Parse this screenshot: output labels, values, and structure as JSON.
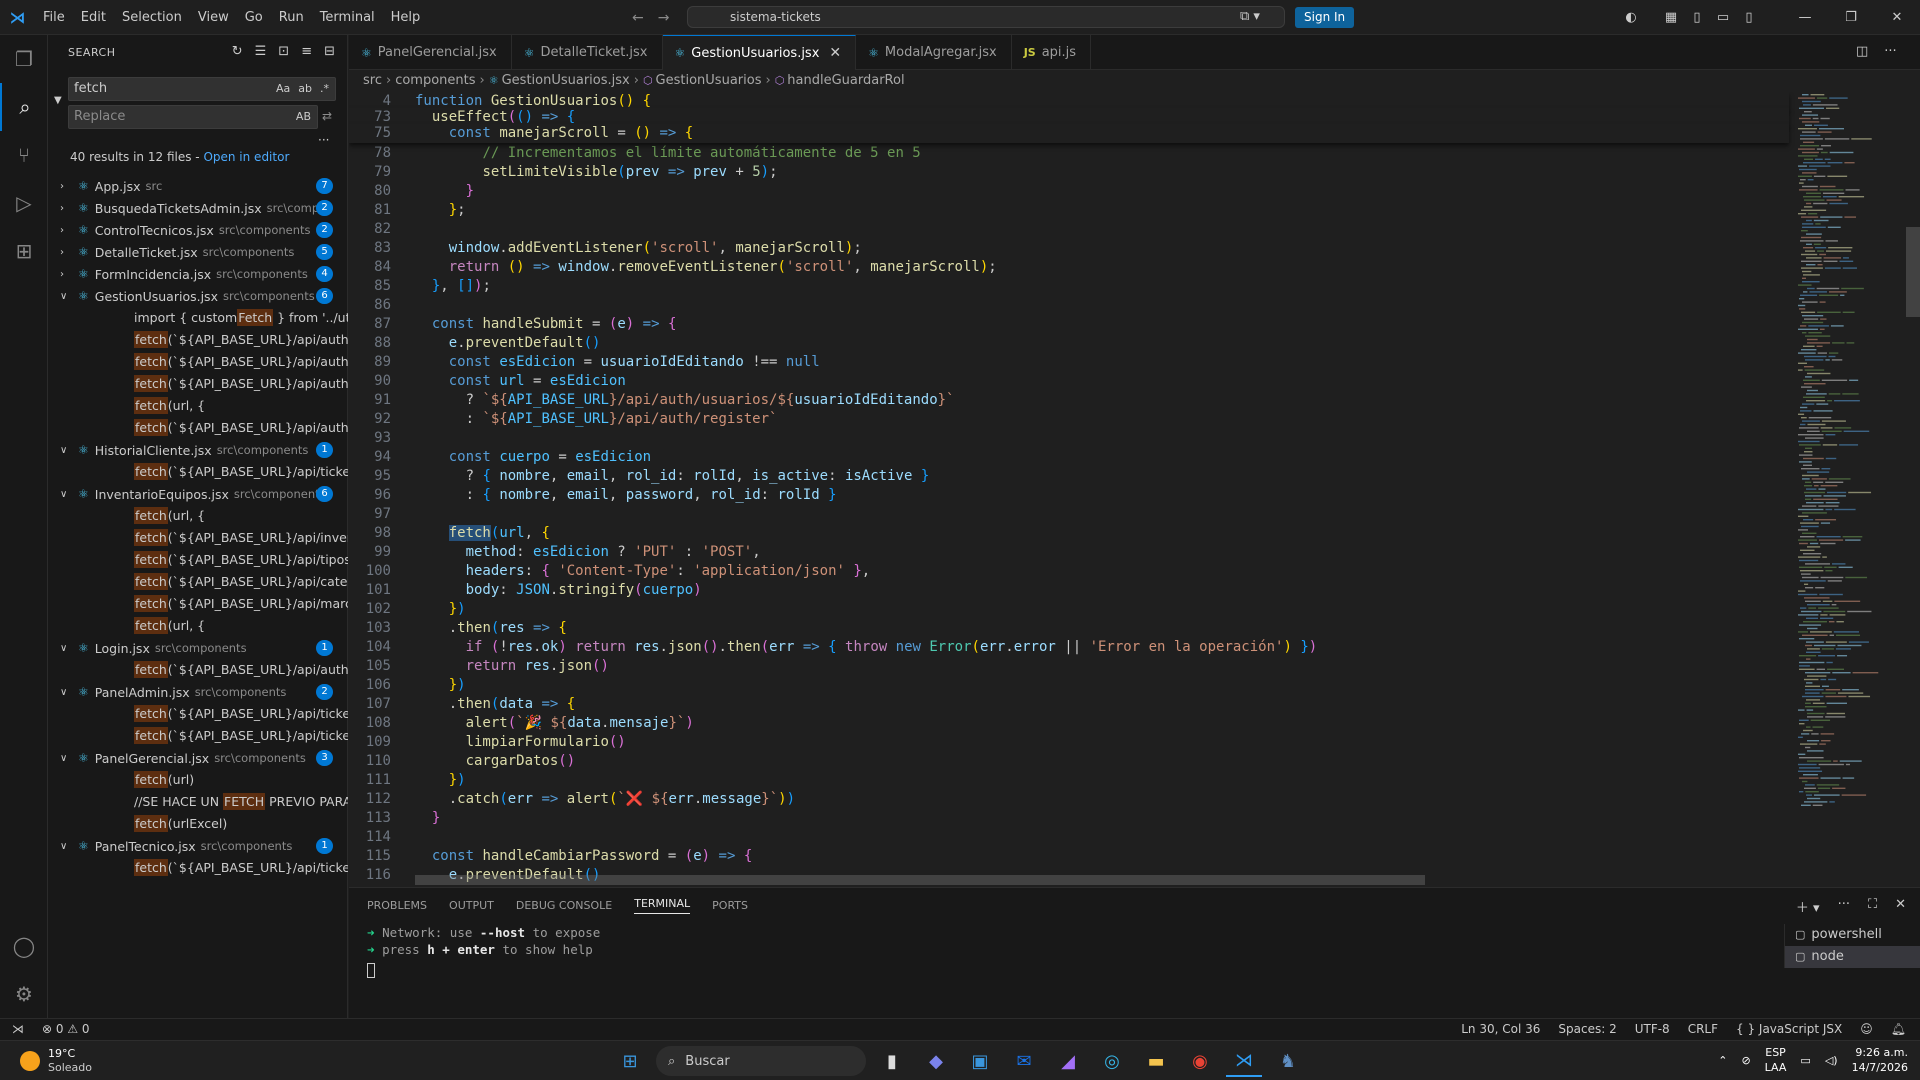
{
  "titlebar": {
    "menu": [
      "File",
      "Edit",
      "Selection",
      "View",
      "Go",
      "Run",
      "Terminal",
      "Help"
    ],
    "search_text": "sistema-tickets",
    "signin_label": "Sign In"
  },
  "sidebar": {
    "title": "SEARCH",
    "search_value": "fetch",
    "search_opts": [
      "Aa",
      "ab",
      ".*"
    ],
    "replace_placeholder": "Replace",
    "replace_opt": "AB",
    "results_summary": "40 results in 12 files - ",
    "open_in_editor": "Open in editor",
    "files": [
      {
        "name": "App.jsx",
        "path": "src",
        "count": "7",
        "expanded": false,
        "matches": []
      },
      {
        "name": "BusquedaTicketsAdmin.jsx",
        "path": "src\\comp...",
        "count": "2",
        "expanded": false,
        "matches": []
      },
      {
        "name": "ControlTecnicos.jsx",
        "path": "src\\components",
        "count": "2",
        "expanded": false,
        "matches": []
      },
      {
        "name": "DetalleTicket.jsx",
        "path": "src\\components",
        "count": "5",
        "expanded": false,
        "matches": []
      },
      {
        "name": "FormIncidencia.jsx",
        "path": "src\\components",
        "count": "4",
        "expanded": false,
        "matches": []
      },
      {
        "name": "GestionUsuarios.jsx",
        "path": "src\\components",
        "count": "6",
        "expanded": true,
        "matches": [
          [
            "import { custom",
            "Fetch",
            " } from '../utils/api';"
          ],
          [
            "",
            "fetch",
            "(`${API_BASE_URL}/api/auth/roles`, {"
          ],
          [
            "",
            "fetch",
            "(`${API_BASE_URL}/api/auth/usuarios`)...."
          ],
          [
            "",
            "fetch",
            "(`${API_BASE_URL}/api/auth/roles`).the..."
          ],
          [
            "",
            "fetch",
            "(url, {"
          ],
          [
            "",
            "fetch",
            "(`${API_BASE_URL}/api/auth/usuarios/$..."
          ]
        ]
      },
      {
        "name": "HistorialCliente.jsx",
        "path": "src\\components",
        "count": "1",
        "expanded": true,
        "matches": [
          [
            "",
            "fetch",
            "(`${API_BASE_URL}/api/tickets/cliente/..."
          ]
        ]
      },
      {
        "name": "InventarioEquipos.jsx",
        "path": "src\\components",
        "count": "6",
        "expanded": true,
        "matches": [
          [
            "",
            "fetch",
            "(url, {"
          ],
          [
            "",
            "fetch",
            "(`${API_BASE_URL}/api/inventario`).the..."
          ],
          [
            "",
            "fetch",
            "(`${API_BASE_URL}/api/tipos-equipos-..."
          ],
          [
            "",
            "fetch",
            "(`${API_BASE_URL}/api/categorias-inve..."
          ],
          [
            "",
            "fetch",
            "(`${API_BASE_URL}/api/marcas`).then(r..."
          ],
          [
            "",
            "fetch",
            "(url, {"
          ]
        ]
      },
      {
        "name": "Login.jsx",
        "path": "src\\components",
        "count": "1",
        "expanded": true,
        "matches": [
          [
            "",
            "fetch",
            "(`${API_BASE_URL}/api/auth/login`, {"
          ]
        ]
      },
      {
        "name": "PanelAdmin.jsx",
        "path": "src\\components",
        "count": "2",
        "expanded": true,
        "matches": [
          [
            "",
            "fetch",
            "(`${API_BASE_URL}/api/tickets/dashboa..."
          ],
          [
            "",
            "fetch",
            "(`${API_BASE_URL}/api/tickets/dashboa..."
          ]
        ]
      },
      {
        "name": "PanelGerencial.jsx",
        "path": "src\\components",
        "count": "3",
        "expanded": true,
        "matches": [
          [
            "",
            "fetch",
            "(url)"
          ],
          [
            "//SE HACE UN ",
            "FETCH",
            " PREVIO PARA EVALUA..."
          ],
          [
            "",
            "fetch",
            "(urlExcel)"
          ]
        ]
      },
      {
        "name": "PanelTecnico.jsx",
        "path": "src\\components",
        "count": "1",
        "expanded": true,
        "matches": [
          [
            "",
            "fetch",
            "(`${API_BASE_URL}/api/tickets/tecnico`)"
          ]
        ]
      }
    ]
  },
  "tabs": [
    {
      "label": "PanelGerencial.jsx",
      "icon": "react-icon",
      "active": false
    },
    {
      "label": "DetalleTicket.jsx",
      "icon": "react-icon",
      "active": false
    },
    {
      "label": "GestionUsuarios.jsx",
      "icon": "react-icon",
      "active": true
    },
    {
      "label": "ModalAgregar.jsx",
      "icon": "react-icon",
      "active": false
    },
    {
      "label": "api.js",
      "icon": "js-icon",
      "active": false
    }
  ],
  "breadcrumb": [
    "src",
    "components",
    "GestionUsuarios.jsx",
    "GestionUsuarios",
    "handleGuardarRol"
  ],
  "code_lines": [
    {
      "n": "4",
      "sticky": true,
      "html": "<span class=\"kw\">function</span> <span class=\"fn\">GestionUsuarios</span><span class=\"br1\">()</span> <span class=\"br1\">{</span>"
    },
    {
      "n": "73",
      "sticky": true,
      "html": "  <span class=\"fn\">useEffect</span><span class=\"br2\">(</span><span class=\"br3\">()</span> <span class=\"kw\">=&gt;</span> <span class=\"br3\">{</span>"
    },
    {
      "n": "75",
      "sticky": true,
      "html": "    <span class=\"kw\">const</span> <span class=\"fn\">manejarScroll</span> = <span class=\"br1\">()</span> <span class=\"kw\">=&gt;</span> <span class=\"br1\">{</span>"
    },
    {
      "n": "78",
      "html": "        <span class=\"com\">// Incrementamos el límite automáticamente de 5 en 5</span>"
    },
    {
      "n": "79",
      "html": "        <span class=\"fn\">setLimiteVisible</span><span class=\"br3\">(</span><span class=\"var\">prev</span> <span class=\"kw\">=&gt;</span> <span class=\"var\">prev</span> + <span class=\"num\">5</span><span class=\"br3\">)</span>;"
    },
    {
      "n": "80",
      "html": "      <span class=\"br2\">}</span>"
    },
    {
      "n": "81",
      "html": "    <span class=\"br1\">}</span>;"
    },
    {
      "n": "82",
      "html": ""
    },
    {
      "n": "83",
      "html": "    <span class=\"var\">window</span>.<span class=\"fn\">addEventListener</span><span class=\"br1\">(</span><span class=\"str\">'scroll'</span>, <span class=\"fn\">manejarScroll</span><span class=\"br1\">)</span>;"
    },
    {
      "n": "84",
      "html": "    <span class=\"kw2\">return</span> <span class=\"br1\">()</span> <span class=\"kw\">=&gt;</span> <span class=\"var\">window</span>.<span class=\"fn\">removeEventListener</span><span class=\"br1\">(</span><span class=\"str\">'scroll'</span>, <span class=\"fn\">manejarScroll</span><span class=\"br1\">)</span>;"
    },
    {
      "n": "85",
      "html": "  <span class=\"br3\">}</span>, <span class=\"br3\">[]</span><span class=\"br2\">)</span>;"
    },
    {
      "n": "86",
      "html": ""
    },
    {
      "n": "87",
      "html": "  <span class=\"kw\">const</span> <span class=\"fn\">handleSubmit</span> = <span class=\"br2\">(</span><span class=\"var\">e</span><span class=\"br2\">)</span> <span class=\"kw\">=&gt;</span> <span class=\"br2\">{</span>"
    },
    {
      "n": "88",
      "html": "    <span class=\"var\">e</span>.<span class=\"fn\">preventDefault</span><span class=\"br3\">()</span>"
    },
    {
      "n": "89",
      "html": "    <span class=\"kw\">const</span> <span class=\"const\">esEdicion</span> = <span class=\"var\">usuarioIdEditando</span> !== <span class=\"kw\">null</span>"
    },
    {
      "n": "90",
      "html": "    <span class=\"kw\">const</span> <span class=\"const\">url</span> = <span class=\"const\">esEdicion</span>"
    },
    {
      "n": "91",
      "html": "      ? <span class=\"str\">`${</span><span class=\"const\">API_BASE_URL</span><span class=\"str\">}/api/auth/usuarios/${</span><span class=\"var\">usuarioIdEditando</span><span class=\"str\">}`</span>"
    },
    {
      "n": "92",
      "html": "      : <span class=\"str\">`${</span><span class=\"const\">API_BASE_URL</span><span class=\"str\">}/api/auth/register`</span>"
    },
    {
      "n": "93",
      "html": ""
    },
    {
      "n": "94",
      "html": "    <span class=\"kw\">const</span> <span class=\"const\">cuerpo</span> = <span class=\"const\">esEdicion</span>"
    },
    {
      "n": "95",
      "html": "      ? <span class=\"br3\">{</span> <span class=\"var\">nombre</span>, <span class=\"var\">email</span>, <span class=\"var\">rol_id</span>: <span class=\"var\">rolId</span>, <span class=\"var\">is_active</span>: <span class=\"var\">isActive</span> <span class=\"br3\">}</span>"
    },
    {
      "n": "96",
      "html": "      : <span class=\"br3\">{</span> <span class=\"var\">nombre</span>, <span class=\"var\">email</span>, <span class=\"var\">password</span>, <span class=\"var\">rol_id</span>: <span class=\"var\">rolId</span> <span class=\"br3\">}</span>"
    },
    {
      "n": "97",
      "html": ""
    },
    {
      "n": "98",
      "html": "    <span class=\"fn hl2\">fetch</span><span class=\"br3\">(</span><span class=\"const\">url</span>, <span class=\"br1\">{</span>"
    },
    {
      "n": "99",
      "html": "      <span class=\"var\">method</span>: <span class=\"const\">esEdicion</span> ? <span class=\"str\">'PUT'</span> : <span class=\"str\">'POST'</span>,"
    },
    {
      "n": "100",
      "html": "      <span class=\"var\">headers</span>: <span class=\"br2\">{</span> <span class=\"str\">'Content-Type'</span>: <span class=\"str\">'application/json'</span> <span class=\"br2\">}</span>,"
    },
    {
      "n": "101",
      "html": "      <span class=\"var\">body</span>: <span class=\"const\">JSON</span>.<span class=\"fn\">stringify</span><span class=\"br2\">(</span><span class=\"const\">cuerpo</span><span class=\"br2\">)</span>"
    },
    {
      "n": "102",
      "html": "    <span class=\"br1\">}</span><span class=\"br3\">)</span>"
    },
    {
      "n": "103",
      "html": "    .<span class=\"fn\">then</span><span class=\"br3\">(</span><span class=\"var\">res</span> <span class=\"kw\">=&gt;</span> <span class=\"br1\">{</span>"
    },
    {
      "n": "104",
      "html": "      <span class=\"kw2\">if</span> <span class=\"br2\">(</span>!<span class=\"var\">res</span>.<span class=\"var\">ok</span><span class=\"br2\">)</span> <span class=\"kw2\">return</span> <span class=\"var\">res</span>.<span class=\"fn\">json</span><span class=\"br2\">()</span>.<span class=\"fn\">then</span><span class=\"br2\">(</span><span class=\"var\">err</span> <span class=\"kw\">=&gt;</span> <span class=\"br3\">{</span> <span class=\"kw2\">throw</span> <span class=\"kw\">new</span> <span class=\"cls\">Error</span><span class=\"br1\">(</span><span class=\"var\">err</span>.<span class=\"var\">error</span> || <span class=\"str\">'Error en la operación'</span><span class=\"br1\">)</span> <span class=\"br3\">}</span><span class=\"br2\">)</span>"
    },
    {
      "n": "105",
      "html": "      <span class=\"kw2\">return</span> <span class=\"var\">res</span>.<span class=\"fn\">json</span><span class=\"br2\">()</span>"
    },
    {
      "n": "106",
      "html": "    <span class=\"br1\">}</span><span class=\"br3\">)</span>"
    },
    {
      "n": "107",
      "html": "    .<span class=\"fn\">then</span><span class=\"br3\">(</span><span class=\"var\">data</span> <span class=\"kw\">=&gt;</span> <span class=\"br1\">{</span>"
    },
    {
      "n": "108",
      "html": "      <span class=\"fn\">alert</span><span class=\"br2\">(</span><span class=\"str\">`🎉 ${</span><span class=\"var\">data</span>.<span class=\"var\">mensaje</span><span class=\"str\">}`</span><span class=\"br2\">)</span>"
    },
    {
      "n": "109",
      "html": "      <span class=\"fn\">limpiarFormulario</span><span class=\"br2\">()</span>"
    },
    {
      "n": "110",
      "html": "      <span class=\"fn\">cargarDatos</span><span class=\"br2\">()</span>"
    },
    {
      "n": "111",
      "html": "    <span class=\"br1\">}</span><span class=\"br3\">)</span>"
    },
    {
      "n": "112",
      "html": "    .<span class=\"fn\">catch</span><span class=\"br3\">(</span><span class=\"var\">err</span> <span class=\"kw\">=&gt;</span> <span class=\"fn\">alert</span><span class=\"br1\">(</span><span class=\"str\">`❌ ${</span><span class=\"var\">err</span>.<span class=\"var\">message</span><span class=\"str\">}`</span><span class=\"br1\">)</span><span class=\"br3\">)</span>"
    },
    {
      "n": "113",
      "html": "  <span class=\"br2\">}</span>"
    },
    {
      "n": "114",
      "html": ""
    },
    {
      "n": "115",
      "html": "  <span class=\"kw\">const</span> <span class=\"fn\">handleCambiarPassword</span> = <span class=\"br2\">(</span><span class=\"var\">e</span><span class=\"br2\">)</span> <span class=\"kw\">=&gt;</span> <span class=\"br2\">{</span>"
    },
    {
      "n": "116",
      "html": "    <span class=\"var\">e</span>.<span class=\"fn\">preventDefault</span><span class=\"br3\">()</span>"
    }
  ],
  "panel": {
    "tabs": [
      "PROBLEMS",
      "OUTPUT",
      "DEBUG CONSOLE",
      "TERMINAL",
      "PORTS"
    ],
    "active_tab": "TERMINAL",
    "terminal_lines": [
      [
        "Network: use ",
        "--host",
        " to expose"
      ],
      [
        "press ",
        "h + enter",
        " to show help"
      ]
    ],
    "terminals": [
      "powershell",
      "node"
    ]
  },
  "status": {
    "errors": "0",
    "warnings": "0",
    "position": "Ln 30, Col 36",
    "spaces": "Spaces: 2",
    "encoding": "UTF-8",
    "eol": "CRLF",
    "language": "JavaScript JSX"
  },
  "taskbar": {
    "temp": "19°C",
    "weather": "Soleado",
    "search_placeholder": "Buscar",
    "lang": "ESP",
    "layout": "LAA",
    "time": "9:26 a.m.",
    "date": "14/7/2026"
  }
}
